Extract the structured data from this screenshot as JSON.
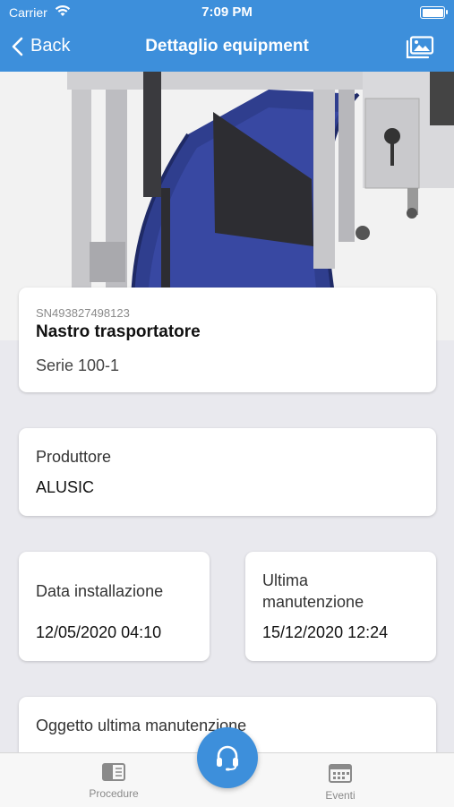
{
  "status_bar": {
    "carrier": "Carrier",
    "time": "7:09 PM"
  },
  "nav": {
    "back_label": "Back",
    "title": "Dettaglio equipment"
  },
  "equipment": {
    "serial": "SN493827498123",
    "name": "Nastro trasportatore",
    "series": "Serie 100-1"
  },
  "producer": {
    "label": "Produttore",
    "value": "ALUSIC"
  },
  "installation": {
    "label": "Data installazione",
    "value": "12/05/2020 04:10"
  },
  "last_maintenance": {
    "label_line1": "Ultima",
    "label_line2": "manutenzione",
    "value": "15/12/2020 12:24"
  },
  "last_maintenance_object": {
    "label": "Oggetto ultima manutenzione"
  },
  "tabs": {
    "procedures": "Procedure",
    "events": "Eventi"
  },
  "colors": {
    "accent": "#3d8fdb",
    "background": "#e9e9ee"
  }
}
